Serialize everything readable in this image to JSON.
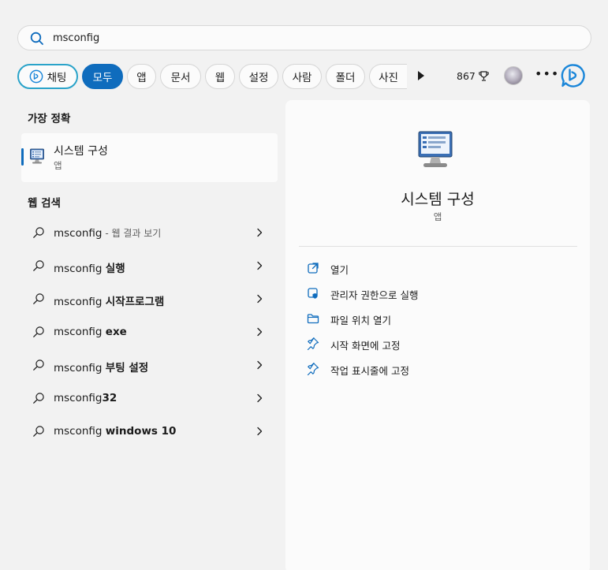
{
  "search": {
    "value": "msconfig"
  },
  "filters": {
    "chat": "채팅",
    "all": "모두",
    "apps": "앱",
    "documents": "문서",
    "web": "웹",
    "settings": "설정",
    "people": "사람",
    "folders": "폴더",
    "photos": "사진",
    "points": "867"
  },
  "best_match": {
    "header": "가장 정확",
    "title": "시스템 구성",
    "subtitle": "앱"
  },
  "web_search": {
    "header": "웹 검색",
    "items": [
      {
        "query": "msconfig",
        "bold": "",
        "suffix": " - 웹 결과 보기"
      },
      {
        "query": "msconfig ",
        "bold": "실행",
        "suffix": ""
      },
      {
        "query": "msconfig ",
        "bold": "시작프로그램",
        "suffix": ""
      },
      {
        "query": "msconfig ",
        "bold": "exe",
        "suffix": ""
      },
      {
        "query": "msconfig ",
        "bold": "부팅 설정",
        "suffix": ""
      },
      {
        "query": "msconfig",
        "bold": "32",
        "suffix": ""
      },
      {
        "query": "msconfig ",
        "bold": "windows 10",
        "suffix": ""
      }
    ]
  },
  "detail": {
    "title": "시스템 구성",
    "subtitle": "앱",
    "actions": {
      "open": "열기",
      "run_as_admin": "관리자 권한으로 실행",
      "open_location": "파일 위치 열기",
      "pin_start": "시작 화면에 고정",
      "pin_taskbar": "작업 표시줄에 고정"
    }
  },
  "colors": {
    "accent": "#0f6cbd",
    "chat_border": "#2aa3c9",
    "bing_blue": "#1a86d9"
  }
}
